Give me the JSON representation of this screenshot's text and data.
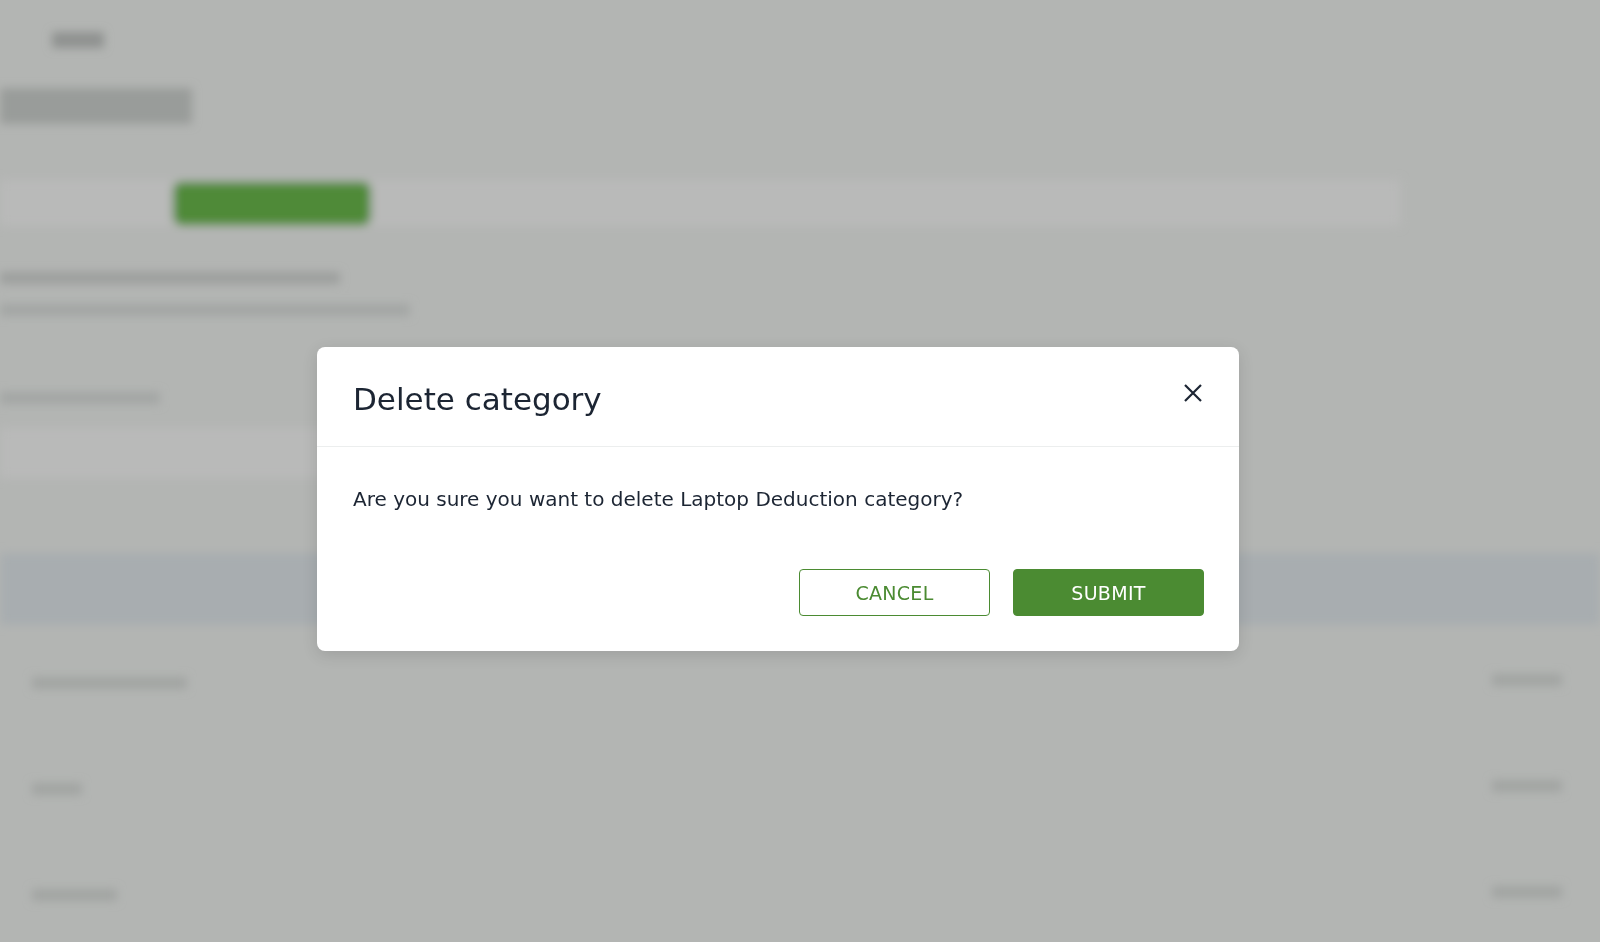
{
  "background": {
    "kind": "blurred-page"
  },
  "dialog": {
    "title": "Delete category",
    "message": "Are you sure you want to delete Laptop Deduction category?",
    "buttons": [
      {
        "label": "CANCEL",
        "kind": "outline"
      },
      {
        "label": "SUBMIT",
        "kind": "primary"
      }
    ]
  }
}
